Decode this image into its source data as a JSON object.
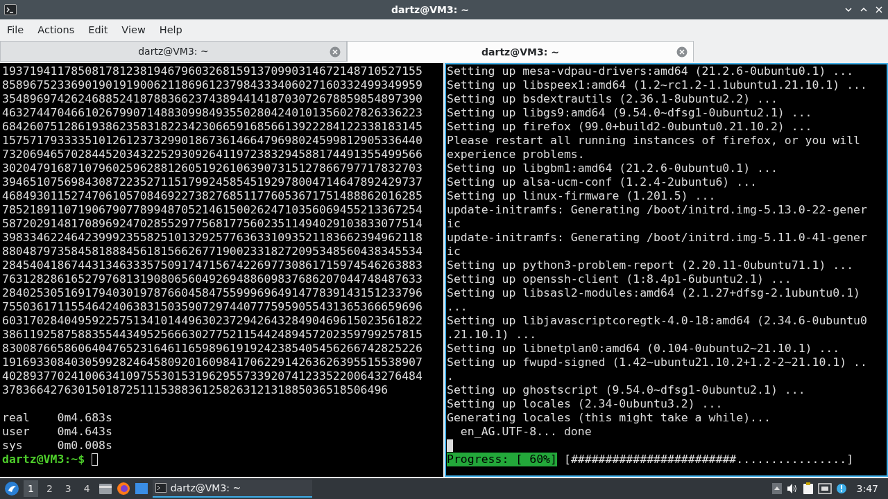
{
  "window": {
    "title": "dartz@VM3: ~"
  },
  "menu": [
    "File",
    "Actions",
    "Edit",
    "View",
    "Help"
  ],
  "tabs": [
    {
      "label": "dartz@VM3: ~",
      "selected": false
    },
    {
      "label": "dartz@VM3: ~",
      "selected": true
    }
  ],
  "panes": [
    {
      "focused": false,
      "lines": [
        {
          "kind": "text",
          "text": "1937194117850817812381946796032681591370990314672148710527155"
        },
        {
          "kind": "text",
          "text": "8589675233690190191900621186961237984333406027160332499349959"
        },
        {
          "kind": "text",
          "text": "3548969742624688524187883662374389441418703072678859854897390"
        },
        {
          "kind": "text",
          "text": "4632744704661026799071488309984935502804240101356027826336223"
        },
        {
          "kind": "text",
          "text": "6842607512861938623583182234230665916856613922284122338183145"
        },
        {
          "kind": "text",
          "text": "1575717933335101261237329901867361466479698024599812905336440"
        },
        {
          "kind": "text",
          "text": "7320694657028445203432252930926411972383294588174491355499566"
        },
        {
          "kind": "text",
          "text": "3020479168710796025962881260519261063907315127866797717832703"
        },
        {
          "kind": "text",
          "text": "3946510756984308722352711517992458545192978004714647892429737"
        },
        {
          "kind": "text",
          "text": "4684930115274706105708469227382768511776053671751488862016285"
        },
        {
          "kind": "text",
          "text": "7852189110719067907789948705214615002624710356069455213367254"
        },
        {
          "kind": "text",
          "text": "5872029148170896924702855297756817756023511494029103833077514"
        },
        {
          "kind": "text",
          "text": "3983346224642399923558251013292577636331093521183662394962118"
        },
        {
          "kind": "text",
          "text": "8804879735845818884561815662677190023318272095348560438345534"
        },
        {
          "kind": "text",
          "text": "2845404186744313463335750917471567422697730861715974546263883"
        },
        {
          "kind": "text",
          "text": "7631282861652797681319080656049269488609837686207044748487633"
        },
        {
          "kind": "text",
          "text": "2840253051691794030197876604584755999696491477839143151233796"
        },
        {
          "kind": "text",
          "text": "7550361711554642406383150359072974407775959055431365366659696"
        },
        {
          "kind": "text",
          "text": "6031702840495922575134101449630237294264328490469615023561822"
        },
        {
          "kind": "text",
          "text": "3861192587588355443495256663027752115442489457202359799257815"
        },
        {
          "kind": "text",
          "text": "8300876658606404765231646116598961919242385405456266742825226"
        },
        {
          "kind": "text",
          "text": "1916933084030599282464580920160984170622914263626395515538907"
        },
        {
          "kind": "text",
          "text": "4028937702410063410975530153196295573392074123352200643276484"
        },
        {
          "kind": "text",
          "text": "37836642763015018725111538836125826312131885036518506496"
        },
        {
          "kind": "blank"
        },
        {
          "kind": "text",
          "text": "real\t0m4.683s"
        },
        {
          "kind": "text",
          "text": "user\t0m4.643s"
        },
        {
          "kind": "text",
          "text": "sys\t0m0.008s"
        },
        {
          "kind": "prompt",
          "text": "dartz@VM3:~$"
        }
      ]
    },
    {
      "focused": true,
      "lines": [
        {
          "kind": "text",
          "text": "Setting up mesa-vdpau-drivers:amd64 (21.2.6-0ubuntu0.1) ..."
        },
        {
          "kind": "text",
          "text": "Setting up libspeex1:amd64 (1.2~rc1.2-1.1ubuntu1.21.10.1) ..."
        },
        {
          "kind": "text",
          "text": "Setting up bsdextrautils (2.36.1-8ubuntu2.2) ..."
        },
        {
          "kind": "text",
          "text": "Setting up libgs9:amd64 (9.54.0~dfsg1-0ubuntu2.1) ..."
        },
        {
          "kind": "text",
          "text": "Setting up firefox (99.0+build2-0ubuntu0.21.10.2) ..."
        },
        {
          "kind": "text",
          "text": "Please restart all running instances of firefox, or you will"
        },
        {
          "kind": "text",
          "text": "experience problems."
        },
        {
          "kind": "text",
          "text": "Setting up libgbm1:amd64 (21.2.6-0ubuntu0.1) ..."
        },
        {
          "kind": "text",
          "text": "Setting up alsa-ucm-conf (1.2.4-2ubuntu6) ..."
        },
        {
          "kind": "text",
          "text": "Setting up linux-firmware (1.201.5) ..."
        },
        {
          "kind": "text",
          "text": "update-initramfs: Generating /boot/initrd.img-5.13.0-22-gener"
        },
        {
          "kind": "text",
          "text": "ic"
        },
        {
          "kind": "text",
          "text": "update-initramfs: Generating /boot/initrd.img-5.11.0-41-gener"
        },
        {
          "kind": "text",
          "text": "ic"
        },
        {
          "kind": "text",
          "text": "Setting up python3-problem-report (2.20.11-0ubuntu71.1) ..."
        },
        {
          "kind": "text",
          "text": "Setting up openssh-client (1:8.4p1-6ubuntu2.1) ..."
        },
        {
          "kind": "text",
          "text": "Setting up libsasl2-modules:amd64 (2.1.27+dfsg-2.1ubuntu0.1)"
        },
        {
          "kind": "text",
          "text": "..."
        },
        {
          "kind": "text",
          "text": "Setting up libjavascriptcoregtk-4.0-18:amd64 (2.34.6-0ubuntu0"
        },
        {
          "kind": "text",
          "text": ".21.10.1) ..."
        },
        {
          "kind": "text",
          "text": "Setting up libnetplan0:amd64 (0.104-0ubuntu2~21.10.1) ..."
        },
        {
          "kind": "text",
          "text": "Setting up fwupd-signed (1.42~ubuntu21.10.2+1.2-2~21.10.1) .."
        },
        {
          "kind": "text",
          "text": "."
        },
        {
          "kind": "text",
          "text": "Setting up ghostscript (9.54.0~dfsg1-0ubuntu2.1) ..."
        },
        {
          "kind": "text",
          "text": "Setting up locales (2.34-0ubuntu3.2) ..."
        },
        {
          "kind": "text",
          "text": "Generating locales (this might take a while)..."
        },
        {
          "kind": "text",
          "text": "  en_AG.UTF-8... done"
        },
        {
          "kind": "cursor"
        },
        {
          "kind": "progress",
          "label": "Progress: [ 60%]",
          "bar": "[########################................]"
        }
      ]
    }
  ],
  "taskbar": {
    "desktops": [
      {
        "label": "1",
        "selected": true
      },
      {
        "label": "2",
        "selected": false
      },
      {
        "label": "3",
        "selected": false
      },
      {
        "label": "4",
        "selected": false
      }
    ],
    "tasks": [
      {
        "label": "dartz@VM3: ~",
        "selected": true
      }
    ],
    "clock": "3:47"
  }
}
